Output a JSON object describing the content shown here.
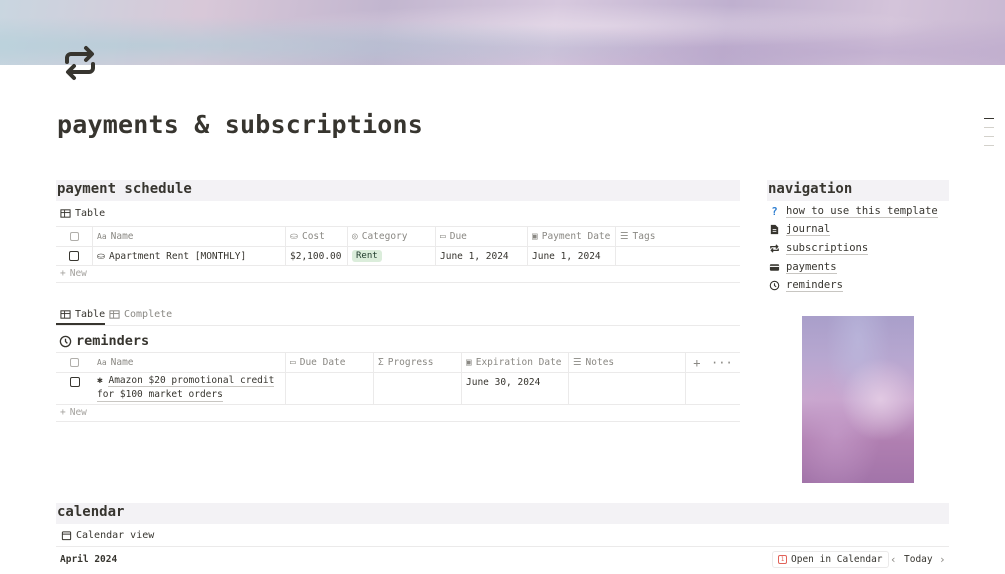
{
  "page": {
    "title": "payments & subscriptions",
    "icon": "repeat-arrows-icon"
  },
  "payment_schedule": {
    "heading": "payment schedule",
    "view_label": "Table",
    "columns": [
      "Name",
      "Cost",
      "Category",
      "Due",
      "Payment Date",
      "Tags"
    ],
    "rows": [
      {
        "name": "Apartment Rent [MONTHLY]",
        "cost": "$2,100.00",
        "category": "Rent",
        "due": "June 1, 2024",
        "payment_date": "June 1, 2024",
        "tags": ""
      }
    ],
    "new_label": "New"
  },
  "reminders": {
    "tabs": [
      {
        "label": "Table"
      },
      {
        "label": "Complete"
      }
    ],
    "title": "reminders",
    "columns": [
      "Name",
      "Due Date",
      "Progress",
      "Expiration Date",
      "Notes"
    ],
    "rows": [
      {
        "name_line1": "Amazon $20 promotional credit",
        "name_line2": "for $100 market orders",
        "due_date": "",
        "progress": "",
        "expiration_date": "June 30, 2024",
        "notes": ""
      }
    ],
    "new_label": "New"
  },
  "navigation": {
    "heading": "navigation",
    "items": [
      {
        "label": "how to use this template",
        "icon": "question-icon"
      },
      {
        "label": "journal",
        "icon": "document-icon"
      },
      {
        "label": "subscriptions",
        "icon": "repeat-icon"
      },
      {
        "label": "payments",
        "icon": "credit-card-icon"
      },
      {
        "label": "reminders",
        "icon": "clock-icon"
      }
    ]
  },
  "calendar": {
    "heading": "calendar",
    "view_label": "Calendar view",
    "month": "April 2024",
    "open_label": "Open in Calendar",
    "today_label": "Today"
  },
  "colors": {
    "text": "#37352f",
    "muted": "#8a8883",
    "section_bg": "#f3f2f5",
    "tag_rent_bg": "#dbeddb",
    "accent_red": "#e16259"
  }
}
